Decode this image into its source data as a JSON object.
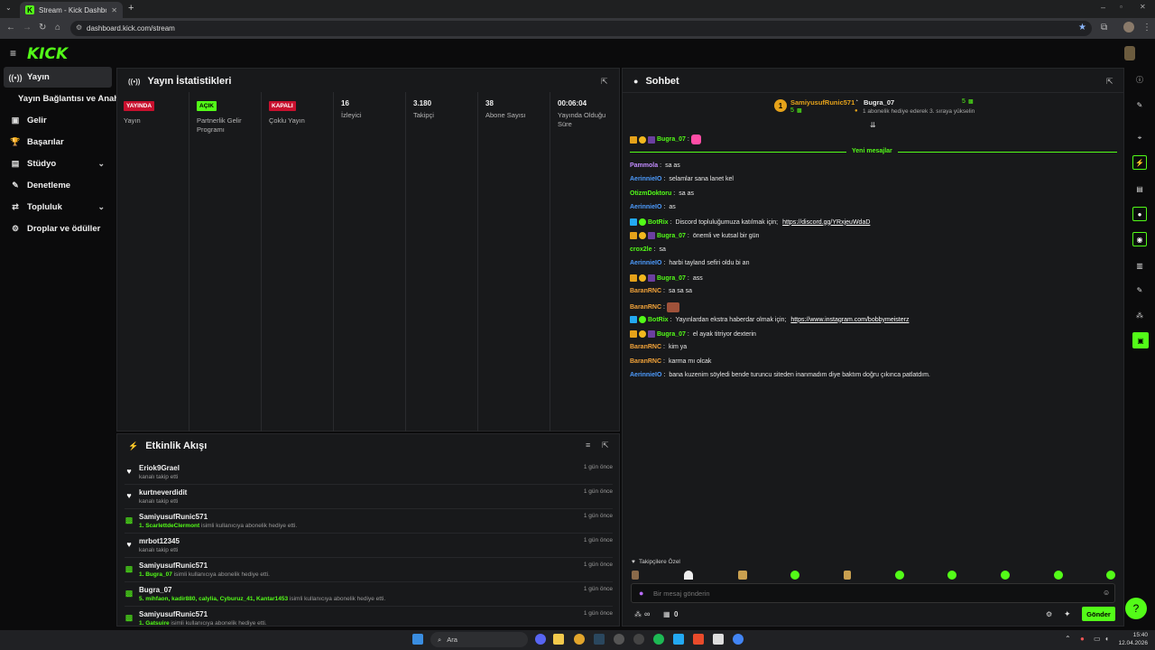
{
  "browser": {
    "tab_title": "Stream - Kick Dashboard",
    "tab_favicon": "K",
    "url": "dashboard.kick.com/stream"
  },
  "logo": "KICK",
  "sidebar": {
    "items": [
      {
        "label": "Yayın",
        "icon": "broadcast-icon"
      },
      {
        "label": "Yayın Bağlantısı ve Anahtarı",
        "icon": ""
      },
      {
        "label": "Gelir",
        "icon": "wallet-icon"
      },
      {
        "label": "Başarılar",
        "icon": "trophy-icon"
      },
      {
        "label": "Stüdyo",
        "icon": "studio-icon"
      },
      {
        "label": "Denetleme",
        "icon": "wrench-icon"
      },
      {
        "label": "Topluluk",
        "icon": "community-icon"
      },
      {
        "label": "Droplar ve ödüller",
        "icon": "drops-icon"
      }
    ]
  },
  "stats": {
    "title": "Yayın İstatistikleri",
    "columns": [
      {
        "badge": "YAYINDA",
        "badge_color": "#c8102e",
        "label": "Yayın",
        "value": ""
      },
      {
        "badge": "AÇIK",
        "badge_color": "#53fc18",
        "label": "Partnerlik Gelir Programı",
        "value": ""
      },
      {
        "badge": "KAPALI",
        "badge_color": "#c8102e",
        "label": "Çoklu Yayın",
        "value": ""
      },
      {
        "badge": "",
        "label": "İzleyici",
        "value": "16"
      },
      {
        "badge": "",
        "label": "Takipçi",
        "value": "3.180"
      },
      {
        "badge": "",
        "label": "Abone Sayısı",
        "value": "38"
      },
      {
        "badge": "",
        "label": "Yayında Olduğu Süre",
        "value": "00:06:04"
      }
    ]
  },
  "activity": {
    "title": "Etkinlik Akışı",
    "rows": [
      {
        "icon": "heart-icon",
        "name": "Eriok9Grael",
        "sub": "kanalı takip etti",
        "highlight": "",
        "time": "1 gün önce"
      },
      {
        "icon": "heart-icon",
        "name": "kurtneverdidit",
        "sub": "kanalı takip etti",
        "highlight": "",
        "time": "1 gün önce"
      },
      {
        "icon": "gift-icon",
        "name": "SamiyusufRunic571",
        "highlight": "1. ScarlettdeClermont",
        "sub": " isimli kullanıcıya abonelik hediye etti.",
        "time": "1 gün önce"
      },
      {
        "icon": "heart-icon",
        "name": "mrbot12345",
        "sub": "kanalı takip etti",
        "highlight": "",
        "time": "1 gün önce"
      },
      {
        "icon": "gift-icon",
        "name": "SamiyusufRunic571",
        "highlight": "1. Bugra_07",
        "sub": " isimli kullanıcıya abonelik hediye etti.",
        "time": "1 gün önce"
      },
      {
        "icon": "gift-icon",
        "name": "Bugra_07",
        "highlight": "5. mihfaon, kadir880, calylia, Cyburuz_41, Kantar1453",
        "sub": " isimli kullanıcıya abonelik hediye etti.",
        "time": "1 gün önce"
      },
      {
        "icon": "gift-icon",
        "name": "SamiyusufRunic571",
        "highlight": "1. Gatsuire",
        "sub": " isimli kullanıcıya abonelik hediye etti.",
        "time": "1 gün önce"
      }
    ]
  },
  "chat": {
    "title": "Sohbet",
    "leader1": {
      "rank": "1",
      "name": "SamiyusufRunic571",
      "count": "5"
    },
    "leader2": {
      "name": "Bugra_07",
      "count": "5",
      "sub": "1 abonelik hediye ederek 3. sıraya yükselin"
    },
    "new_messages": "Yeni mesajlar",
    "pinned_user": "Bugra_07",
    "messages": [
      {
        "user": "Pammola",
        "color": "#c28cff",
        "text": "sa as",
        "badges": 0
      },
      {
        "user": "AerinnieIO",
        "color": "#4d9cff",
        "text": "selamlar sana lanet kel",
        "badges": 0
      },
      {
        "user": "OtizmDoktoru",
        "color": "#53fc18",
        "text": "sa as",
        "badges": 0
      },
      {
        "user": "AerinnieIO",
        "color": "#4d9cff",
        "text": "as",
        "badges": 0
      },
      {
        "user": "BotRix",
        "color": "#53fc18",
        "text": "Discord topluluğumuza katılmak için;",
        "link": "https://discord.gg/YRxjeuWdaD",
        "badges": 2
      },
      {
        "user": "Bugra_07",
        "color": "#53fc18",
        "text": "önemli ve kutsal bir gün",
        "badges": 3
      },
      {
        "user": "crox2le",
        "color": "#53fc18",
        "text": "sa",
        "badges": 0
      },
      {
        "user": "AerinnieIO",
        "color": "#4d9cff",
        "text": "harbi tayland sefiri oldu bi an",
        "badges": 0
      },
      {
        "user": "Bugra_07",
        "color": "#53fc18",
        "text": "ass",
        "badges": 3
      },
      {
        "user": "BaranRNC",
        "color": "#f2a33a",
        "text": "sa sa sa",
        "badges": 0
      },
      {
        "user": "BaranRNC",
        "color": "#f2a33a",
        "text": "",
        "emote": true,
        "badges": 0
      },
      {
        "user": "BotRix",
        "color": "#53fc18",
        "text": "Yayınlardan ekstra haberdar olmak için;",
        "link": "https://www.instagram.com/bobbymeisterz",
        "badges": 2
      },
      {
        "user": "Bugra_07",
        "color": "#53fc18",
        "text": "el ayak titriyor dexterin",
        "badges": 3
      },
      {
        "user": "BaranRNC",
        "color": "#f2a33a",
        "text": "kim ya",
        "badges": 0
      },
      {
        "user": "BaranRNC",
        "color": "#f2a33a",
        "text": "karma mı olcak",
        "badges": 0
      },
      {
        "user": "AerinnieIO",
        "color": "#4d9cff",
        "text": "bana kuzenim söyledi bende turuncu siteden inanmadım diye baktım doğru çıkınca patlatdım.",
        "badges": 0
      }
    ],
    "followers_only": "Takipçilere Özel",
    "input_placeholder": "Bir mesaj gönderin",
    "points": "0",
    "infinity": "∞",
    "send_label": "Gönder"
  },
  "taskbar": {
    "search": "Ara",
    "time": "15:40",
    "date": "12.04.2026"
  },
  "colors": {
    "accent": "#53fc18",
    "panel": "#18191b",
    "bg": "#0b0b0c"
  }
}
